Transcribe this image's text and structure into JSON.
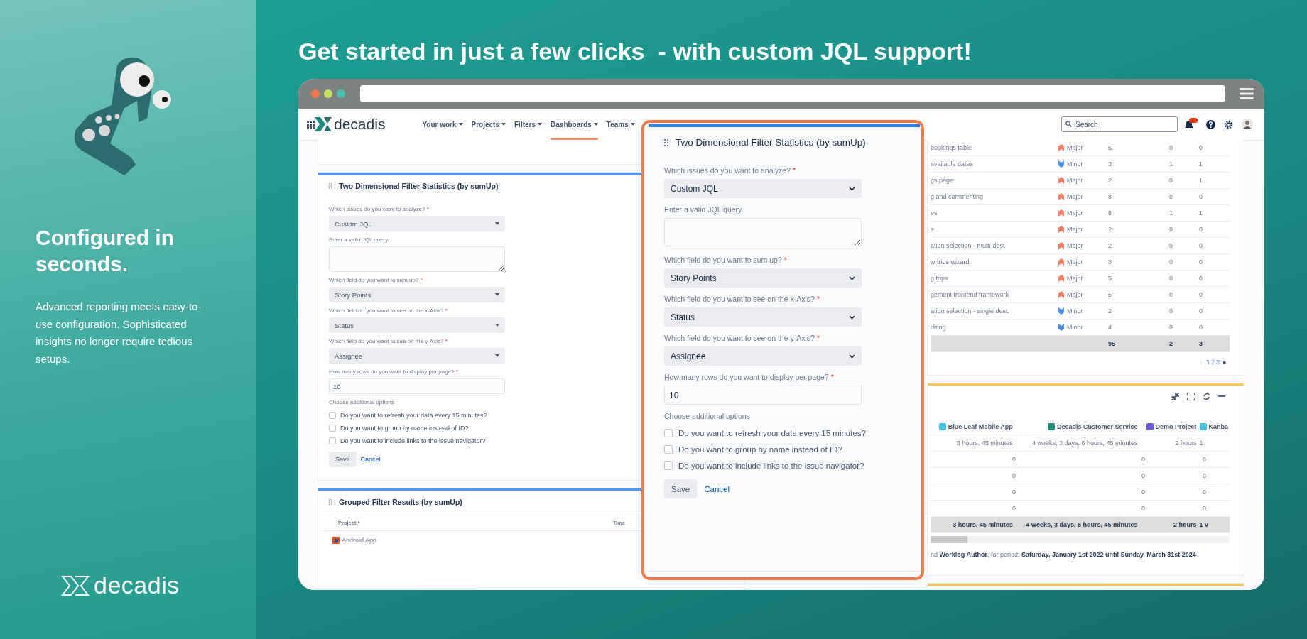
{
  "sidebar": {
    "heading": "Configured in seconds.",
    "body": "Advanced reporting meets easy-to-use configuration. Sophisticated insights no longer require tedious setups.",
    "logo_text": "decadis"
  },
  "headline": "Get started in just a few clicks  - with custom JQL support!",
  "nav": {
    "logo_text": "decadis",
    "items": [
      {
        "label": "Your work",
        "selected": false
      },
      {
        "label": "Projects",
        "selected": false
      },
      {
        "label": "Filters",
        "selected": false
      },
      {
        "label": "Dashboards",
        "selected": true
      },
      {
        "label": "Teams",
        "selected": false
      }
    ],
    "search_placeholder": "Search"
  },
  "background_gadget": {
    "title": "Two Dimensional Filter Statistics (by sumUp)",
    "fields": [
      {
        "kind": "select",
        "label": "Which issues do you want to analyze?",
        "required_mark": "*",
        "value": "Custom JQL"
      },
      {
        "kind": "textarea",
        "label": "Enter a valid JQL query."
      },
      {
        "kind": "select",
        "label": "Which field do you want to sum up?",
        "required_mark": "*",
        "value": "Story Points"
      },
      {
        "kind": "select",
        "label": "Which field do you want to see on the x-Axis?",
        "required_mark": "*",
        "value": "Status"
      },
      {
        "kind": "select",
        "label": "Which field do you want to see on the y-Axis?",
        "required_mark": "*",
        "value": "Assignee"
      },
      {
        "kind": "text",
        "label": "How many rows do you want to display per page?",
        "required_mark": "*",
        "value": "10"
      }
    ],
    "options_heading": "Choose additional options",
    "options": [
      {
        "label": "Do you want to refresh your data every 15 minutes?",
        "checked": false
      },
      {
        "label": "Do you want to group by name instead of ID?",
        "checked": false
      },
      {
        "label": "Do you want to include links to the issue navigator?",
        "checked": false
      }
    ],
    "save": "Save",
    "cancel": "Cancel"
  },
  "grouped_gadget": {
    "title": "Grouped Filter Results (by sumUp)",
    "columns": [
      "Project *",
      "Time"
    ],
    "rows": [
      {
        "project": "Android App"
      }
    ]
  },
  "modal": {
    "title": "Two Dimensional Filter Statistics (by sumUp)",
    "fields": [
      {
        "kind": "select",
        "label": "Which issues do you want to analyze?",
        "required_mark": "*",
        "value": "Custom JQL"
      },
      {
        "kind": "textarea",
        "label": "Enter a valid JQL query."
      },
      {
        "kind": "select",
        "label": "Which field do you want to sum up?",
        "required_mark": "*",
        "value": "Story Points"
      },
      {
        "kind": "select",
        "label": "Which field do you want to see on the x-Axis?",
        "required_mark": "*",
        "value": "Status"
      },
      {
        "kind": "select",
        "label": "Which field do you want to see on the y-Axis?",
        "required_mark": "*",
        "value": "Assignee"
      },
      {
        "kind": "text",
        "label": "How many rows do you want to display per page?",
        "required_mark": "*",
        "value": "10"
      }
    ],
    "options_heading": "Choose additional options",
    "options": [
      {
        "label": "Do you want to refresh your data every 15 minutes?",
        "checked": false
      },
      {
        "label": "Do you want to group by name instead of ID?",
        "checked": false
      },
      {
        "label": "Do you want to include links to the issue navigator?",
        "checked": false
      }
    ],
    "save": "Save",
    "cancel": "Cancel"
  },
  "issue_table": {
    "rows": [
      {
        "summary": "bookings table",
        "kind": "major",
        "priority": "Major",
        "values": [
          "5",
          "0",
          "0"
        ]
      },
      {
        "summary": "available dates",
        "kind": "minor",
        "priority": "Minor",
        "values": [
          "3",
          "1",
          "1"
        ]
      },
      {
        "summary": "gs page",
        "kind": "major",
        "priority": "Major",
        "values": [
          "2",
          "0",
          "1"
        ]
      },
      {
        "summary": "g and commenting",
        "kind": "major",
        "priority": "Major",
        "values": [
          "8",
          "0",
          "0"
        ]
      },
      {
        "summary": "es",
        "kind": "major",
        "priority": "Major",
        "values": [
          "8",
          "1",
          "1"
        ]
      },
      {
        "summary": "s",
        "kind": "major",
        "priority": "Major",
        "values": [
          "2",
          "0",
          "0"
        ]
      },
      {
        "summary": "ation selection - multi-dest",
        "kind": "major",
        "priority": "Major",
        "values": [
          "2",
          "0",
          "0"
        ]
      },
      {
        "summary": "w trips wizard",
        "kind": "major",
        "priority": "Major",
        "values": [
          "3",
          "0",
          "0"
        ]
      },
      {
        "summary": "g trips",
        "kind": "major",
        "priority": "Major",
        "values": [
          "5",
          "0",
          "0"
        ]
      },
      {
        "summary": "gement frontend framework",
        "kind": "major",
        "priority": "Major",
        "values": [
          "5",
          "0",
          "0"
        ]
      },
      {
        "summary": "ation selection - single dest.",
        "kind": "minor",
        "priority": "Minor",
        "values": [
          "2",
          "0",
          "0"
        ]
      },
      {
        "summary": "diting",
        "kind": "minor",
        "priority": "Minor",
        "values": [
          "4",
          "0",
          "0"
        ]
      }
    ],
    "totals": [
      "95",
      "2",
      "3"
    ],
    "pagination": {
      "previous": "‹",
      "pages": [
        {
          "label": "1",
          "selected": true
        },
        {
          "label": "2",
          "selected": false
        },
        {
          "label": "3",
          "selected": false
        }
      ],
      "next": "▸"
    }
  },
  "worklog_table": {
    "columns": [
      {
        "label": "Blue Leaf Mobile App",
        "color": "#4bc3e0"
      },
      {
        "label": "Decadis Customer Service",
        "color": "#1f8a7a"
      },
      {
        "label": "Demo Project",
        "color": "#6b5bd6"
      },
      {
        "label": "Kanba",
        "color": "#4bc3e0"
      }
    ],
    "rows": [
      [
        "3 hours, 45 minutes",
        "4 weeks, 3 days, 6 hours, 45 minutes",
        "2 hours",
        "1"
      ],
      [
        "0",
        "0",
        "0"
      ],
      [
        "0",
        "0",
        "0"
      ],
      [
        "0",
        "0",
        "0"
      ],
      [
        "0",
        "0",
        "0"
      ]
    ],
    "totals": [
      "3 hours, 45 minutes",
      "4 weeks, 3 days, 6 hours, 45 minutes",
      "2 hours",
      "1 v"
    ],
    "footer": "nd **Worklog Author**, for period: **Saturday, January 1st 2022 until Sunday, March 31st 2024**"
  }
}
